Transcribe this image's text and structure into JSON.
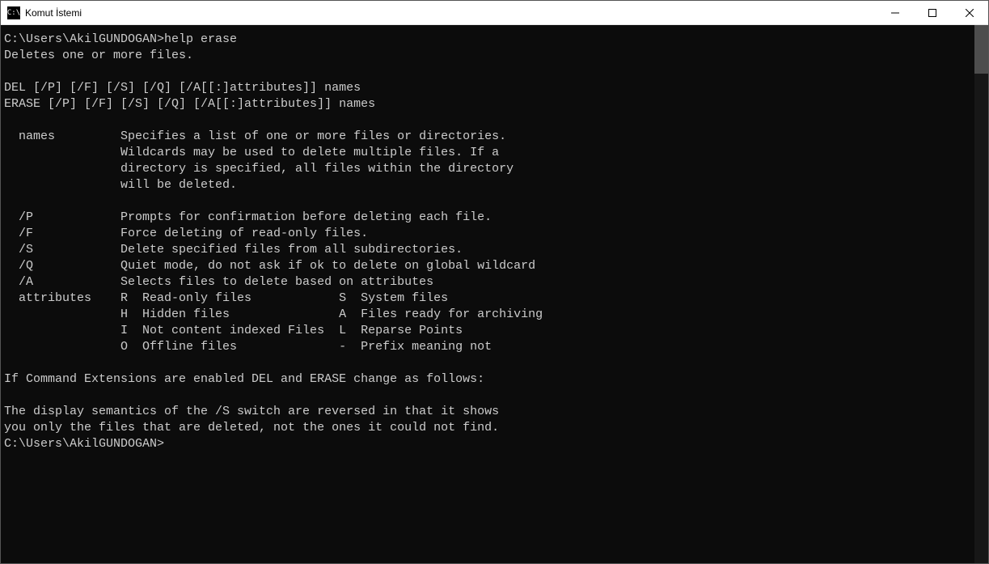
{
  "window": {
    "title": "Komut İstemi",
    "icon_label": "C:\\"
  },
  "terminal": {
    "prompt1_path": "C:\\Users\\AkilGUNDOGAN>",
    "prompt1_cmd": "help erase",
    "output_lines": [
      "Deletes one or more files.",
      "",
      "DEL [/P] [/F] [/S] [/Q] [/A[[:]attributes]] names",
      "ERASE [/P] [/F] [/S] [/Q] [/A[[:]attributes]] names",
      "",
      "  names         Specifies a list of one or more files or directories.",
      "                Wildcards may be used to delete multiple files. If a",
      "                directory is specified, all files within the directory",
      "                will be deleted.",
      "",
      "  /P            Prompts for confirmation before deleting each file.",
      "  /F            Force deleting of read-only files.",
      "  /S            Delete specified files from all subdirectories.",
      "  /Q            Quiet mode, do not ask if ok to delete on global wildcard",
      "  /A            Selects files to delete based on attributes",
      "  attributes    R  Read-only files            S  System files",
      "                H  Hidden files               A  Files ready for archiving",
      "                I  Not content indexed Files  L  Reparse Points",
      "                O  Offline files              -  Prefix meaning not",
      "",
      "If Command Extensions are enabled DEL and ERASE change as follows:",
      "",
      "The display semantics of the /S switch are reversed in that it shows",
      "you only the files that are deleted, not the ones it could not find.",
      ""
    ],
    "prompt2_path": "C:\\Users\\AkilGUNDOGAN>",
    "prompt2_cmd": ""
  }
}
